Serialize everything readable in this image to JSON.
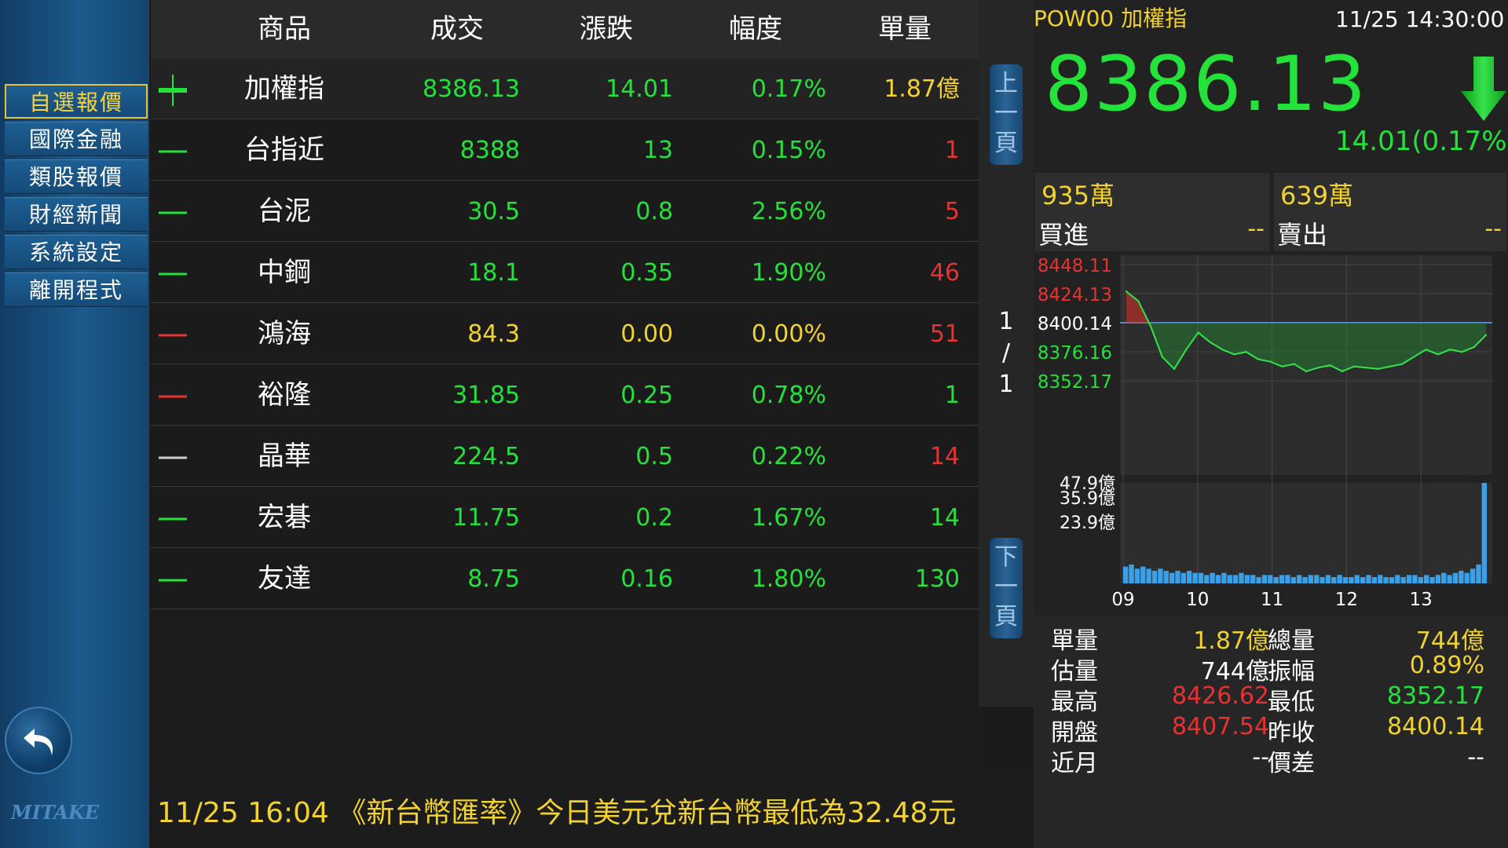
{
  "sidebar": {
    "items": [
      {
        "label": "自選報價",
        "active": true
      },
      {
        "label": "國際金融"
      },
      {
        "label": "類股報價"
      },
      {
        "label": "財經新聞"
      },
      {
        "label": "系統設定"
      },
      {
        "label": "離開程式"
      }
    ],
    "back_icon": "back-arrow-icon",
    "logo": "MITAKE"
  },
  "table": {
    "headers": [
      "商品",
      "成交",
      "漲跌",
      "幅度",
      "單量"
    ],
    "rows": [
      {
        "name": "加權指",
        "price": "8386.13",
        "change": "14.01",
        "pct": "0.17%",
        "vol": "1.87億",
        "price_color": "#23e23a",
        "change_color": "#23e23a",
        "pct_color": "#23e23a",
        "vol_color": "#f2d22e"
      },
      {
        "name": "台指近",
        "price": "8388",
        "change": "13",
        "pct": "0.15%",
        "vol": "1",
        "price_color": "#23e23a",
        "change_color": "#23e23a",
        "pct_color": "#23e23a",
        "vol_color": "#e83232"
      },
      {
        "name": "台泥",
        "price": "30.5",
        "change": "0.8",
        "pct": "2.56%",
        "vol": "5",
        "price_color": "#23e23a",
        "change_color": "#23e23a",
        "pct_color": "#23e23a",
        "vol_color": "#e83232"
      },
      {
        "name": "中鋼",
        "price": "18.1",
        "change": "0.35",
        "pct": "1.90%",
        "vol": "46",
        "price_color": "#23e23a",
        "change_color": "#23e23a",
        "pct_color": "#23e23a",
        "vol_color": "#e83232"
      },
      {
        "name": "鴻海",
        "price": "84.3",
        "change": "0.00",
        "pct": "0.00%",
        "vol": "51",
        "price_color": "#f2d22e",
        "change_color": "#f2d22e",
        "pct_color": "#f2d22e",
        "vol_color": "#e83232"
      },
      {
        "name": "裕隆",
        "price": "31.85",
        "change": "0.25",
        "pct": "0.78%",
        "vol": "1",
        "price_color": "#23e23a",
        "change_color": "#23e23a",
        "pct_color": "#23e23a",
        "vol_color": "#23e23a"
      },
      {
        "name": "晶華",
        "price": "224.5",
        "change": "0.5",
        "pct": "0.22%",
        "vol": "14",
        "price_color": "#23e23a",
        "change_color": "#23e23a",
        "pct_color": "#23e23a",
        "vol_color": "#e83232"
      },
      {
        "name": "宏碁",
        "price": "11.75",
        "change": "0.2",
        "pct": "1.67%",
        "vol": "14",
        "price_color": "#23e23a",
        "change_color": "#23e23a",
        "pct_color": "#23e23a",
        "vol_color": "#23e23a"
      },
      {
        "name": "友達",
        "price": "8.75",
        "change": "0.16",
        "pct": "1.80%",
        "vol": "130",
        "price_color": "#23e23a",
        "change_color": "#23e23a",
        "pct_color": "#23e23a",
        "vol_color": "#23e23a"
      }
    ]
  },
  "pager": {
    "up_label": "上一頁",
    "down_label": "下一頁",
    "current": "1",
    "sep": "/",
    "total": "1"
  },
  "ticker": {
    "text": "11/25 16:04 《新台幣匯率》今日美元兌新台幣最低為32.48元"
  },
  "quote": {
    "title": "POW00 加權指",
    "time": "11/25 14:30:00",
    "price": "8386.13",
    "change_text": "14.01(0.17%)",
    "direction_icon": "down-arrow-icon",
    "buy_volume": "935萬",
    "buy_label": "買進",
    "buy_value": "--",
    "sell_volume": "639萬",
    "sell_label": "賣出",
    "sell_value": "--"
  },
  "stats": {
    "rows": [
      {
        "l1": "單量",
        "v1": "1.87億",
        "c1": "#f2d22e",
        "l2": "總量",
        "v2": "744億",
        "c2": "#f2d22e"
      },
      {
        "l1": "估量",
        "v1": "744億",
        "c1": "#ffffff",
        "l2": "振幅",
        "v2": "0.89%",
        "c2": "#f2d22e"
      },
      {
        "l1": "最高",
        "v1": "8426.62",
        "c1": "#e83232",
        "l2": "最低",
        "v2": "8352.17",
        "c2": "#23e23a"
      },
      {
        "l1": "開盤",
        "v1": "8407.54",
        "c1": "#e83232",
        "l2": "昨收",
        "v2": "8400.14",
        "c2": "#f2d22e"
      },
      {
        "l1": "近月",
        "v1": "--",
        "c1": "#ffffff",
        "l2": "價差",
        "v2": "--",
        "c2": "#ffffff"
      }
    ]
  },
  "chart_data": [
    {
      "type": "line",
      "y_ticks": [
        "8448.11",
        "8424.13",
        "8400.14",
        "8376.16",
        "8352.17"
      ],
      "y_tick_colors": [
        "#e83232",
        "#e83232",
        "#ffffff",
        "#23e23a",
        "#23e23a"
      ],
      "reference": 8400.14,
      "ylim": [
        8352.17,
        8448.11
      ],
      "x_ticks": [
        "09",
        "10",
        "11",
        "12",
        "13"
      ],
      "x": [
        "09:00",
        "09:05",
        "09:10",
        "09:15",
        "09:20",
        "09:25",
        "09:30",
        "09:40",
        "09:50",
        "10:00",
        "10:10",
        "10:20",
        "10:30",
        "10:40",
        "10:50",
        "11:00",
        "11:10",
        "11:20",
        "11:30",
        "11:40",
        "11:50",
        "12:00",
        "12:10",
        "12:20",
        "12:30",
        "12:40",
        "12:50",
        "13:00",
        "13:10",
        "13:20",
        "13:30"
      ],
      "y": [
        8426,
        8418,
        8398,
        8372,
        8362,
        8378,
        8392,
        8384,
        8378,
        8374,
        8376,
        8370,
        8368,
        8364,
        8366,
        8360,
        8363,
        8365,
        8360,
        8364,
        8363,
        8362,
        8364,
        8366,
        8372,
        8378,
        8374,
        8378,
        8376,
        8380,
        8390
      ],
      "grid": true
    },
    {
      "type": "bar",
      "y_ticks": [
        "47.9億",
        "35.9億",
        "23.9億"
      ],
      "x_ticks": [
        "09",
        "10",
        "11",
        "12",
        "13"
      ],
      "values": [
        8,
        9,
        7,
        8,
        7,
        6,
        7,
        6,
        5,
        6,
        5,
        6,
        5,
        5,
        4,
        5,
        4,
        5,
        4,
        4,
        5,
        4,
        4,
        3,
        4,
        4,
        3,
        4,
        4,
        3,
        4,
        3,
        4,
        4,
        3,
        4,
        3,
        4,
        3,
        3,
        4,
        3,
        4,
        3,
        4,
        3,
        3,
        4,
        3,
        4,
        4,
        3,
        4,
        3,
        4,
        5,
        4,
        5,
        6,
        5,
        7,
        9,
        47.9
      ],
      "color": "#3aa0e8"
    }
  ]
}
